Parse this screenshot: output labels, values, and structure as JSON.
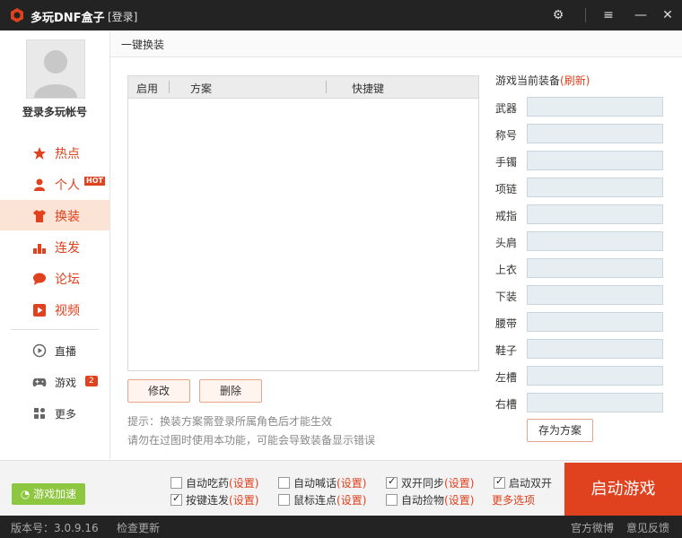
{
  "titlebar": {
    "title": "多玩DNF盒子",
    "login": "[登录]",
    "icons": [
      "gear-icon",
      "menu-icon",
      "minimize-icon",
      "close-icon"
    ]
  },
  "sidebar": {
    "account_label": "登录多玩帐号",
    "items": [
      {
        "label": "热点",
        "icon": "star-icon"
      },
      {
        "label": "个人",
        "icon": "person-icon",
        "tag": "HOT"
      },
      {
        "label": "换装",
        "icon": "shirt-icon",
        "active": true
      },
      {
        "label": "连发",
        "icon": "bars-icon"
      },
      {
        "label": "论坛",
        "icon": "chat-icon"
      },
      {
        "label": "视频",
        "icon": "video-icon"
      },
      {
        "label": "直播",
        "icon": "play-circle-icon"
      },
      {
        "label": "游戏",
        "icon": "gamepad-icon",
        "badge": "2"
      },
      {
        "label": "更多",
        "icon": "grid-icon"
      }
    ]
  },
  "content": {
    "title": "一键换装",
    "table": {
      "columns": [
        "启用",
        "方案",
        "快捷键"
      ],
      "rows": []
    },
    "buttons": {
      "edit": "修改",
      "delete": "删除"
    },
    "tips": [
      "提示：换装方案需登录所属角色后才能生效",
      "请勿在过图时使用本功能，可能会导致装备显示错误"
    ]
  },
  "equipment": {
    "title": "游戏当前装备",
    "refresh": "(刷新)",
    "slots": [
      "武器",
      "称号",
      "手镯",
      "项链",
      "戒指",
      "头肩",
      "上衣",
      "下装",
      "腰带",
      "鞋子",
      "左槽",
      "右槽"
    ],
    "save_label": "存为方案"
  },
  "footer": {
    "accelerate_label": "游戏加速",
    "options": [
      {
        "label": "自动吃药",
        "setting": "(设置)",
        "checked": false
      },
      {
        "label": "自动喊话",
        "setting": "(设置)",
        "checked": false
      },
      {
        "label": "双开同步",
        "setting": "(设置)",
        "checked": true
      },
      {
        "label": "启动双开",
        "setting": "",
        "checked": true
      },
      {
        "label": "按键连发",
        "setting": "(设置)",
        "checked": true
      },
      {
        "label": "鼠标连点",
        "setting": "(设置)",
        "checked": false
      },
      {
        "label": "自动捡物",
        "setting": "(设置)",
        "checked": false
      }
    ],
    "more_options": "更多选项",
    "launch_label": "启动游戏"
  },
  "statusbar": {
    "version": "版本号：3.0.9.16",
    "check_update": "检查更新",
    "weibo": "官方微博",
    "feedback": "意见反馈"
  },
  "colors": {
    "accent": "#e0411e",
    "titlebar": "#232323",
    "active_nav": "#fbe3d6",
    "accelerate": "#8dc63f"
  }
}
